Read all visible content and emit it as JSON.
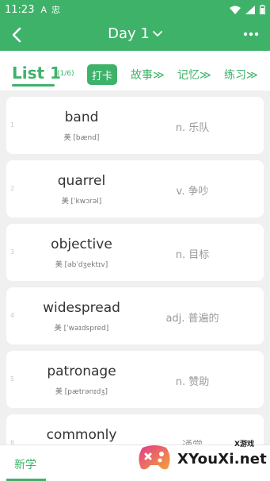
{
  "status": {
    "time": "11:23",
    "icon_a": "A",
    "icon_b": "忠"
  },
  "header": {
    "title": "Day 1"
  },
  "tabs": {
    "list_label": "List 1",
    "list_count": "(1/6)",
    "checkin": "打卡",
    "story": "故事≫",
    "memory": "记忆≫",
    "practice": "练习≫"
  },
  "words": [
    {
      "index": "1",
      "word": "band",
      "phonetic": "美 [bænd]",
      "meaning": "n. 乐队"
    },
    {
      "index": "2",
      "word": "quarrel",
      "phonetic": "美 [ˈkwɔrəl]",
      "meaning": "v. 争吵"
    },
    {
      "index": "3",
      "word": "objective",
      "phonetic": "美 [əbˈdʒektɪv]",
      "meaning": "n. 目标"
    },
    {
      "index": "4",
      "word": "widespread",
      "phonetic": "美 [ˈwaɪdspred]",
      "meaning": "adj. 普遍的"
    },
    {
      "index": "5",
      "word": "patronage",
      "phonetic": "美 [pætrənɪdʒ]",
      "meaning": "n. 赞助"
    },
    {
      "index": "6",
      "word": "commonly",
      "phonetic": "",
      "meaning": "通常"
    }
  ],
  "bottom": {
    "tab_label": "新学"
  },
  "watermark": {
    "text": "XYouXi.net",
    "small": "X游戏"
  },
  "colors": {
    "accent": "#3fb26a",
    "background": "#f0f0f0"
  }
}
